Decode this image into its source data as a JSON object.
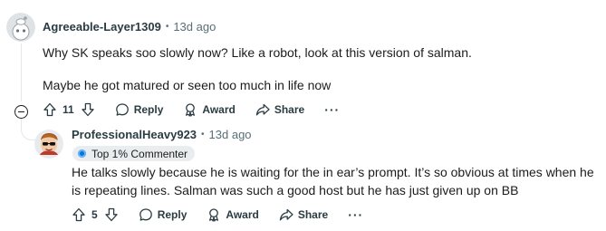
{
  "comments": [
    {
      "author": "Agreeable-Layer1309",
      "separator": "•",
      "time": "13d ago",
      "paragraphs": [
        "Why SK speaks soo slowly now? Like a robot, look at this version of salman.",
        "Maybe he got matured or seen too much in life now"
      ],
      "votes": "11",
      "reply_label": "Reply",
      "award_label": "Award",
      "share_label": "Share",
      "more_label": "···"
    },
    {
      "author": "ProfessionalHeavy923",
      "separator": "•",
      "time": "13d ago",
      "flair": "Top 1% Commenter",
      "paragraphs": [
        "He talks slowly because he is waiting for the in ear’s prompt. It’s so obvious at times when he is repeating lines. Salman was such a good host but he has just given up on BB"
      ],
      "votes": "5",
      "reply_label": "Reply",
      "award_label": "Award",
      "share_label": "Share",
      "more_label": "···"
    }
  ],
  "icons": {
    "avatar_1": "snoo-avatar-icon",
    "avatar_2": "sunglasses-avatar-icon",
    "upvote": "arrow-up-icon",
    "downvote": "arrow-down-icon",
    "reply": "speech-bubble-icon",
    "award": "award-icon",
    "share": "share-arrow-icon",
    "collapse": "collapse-minus-icon",
    "flair": "flair-badge-icon"
  }
}
